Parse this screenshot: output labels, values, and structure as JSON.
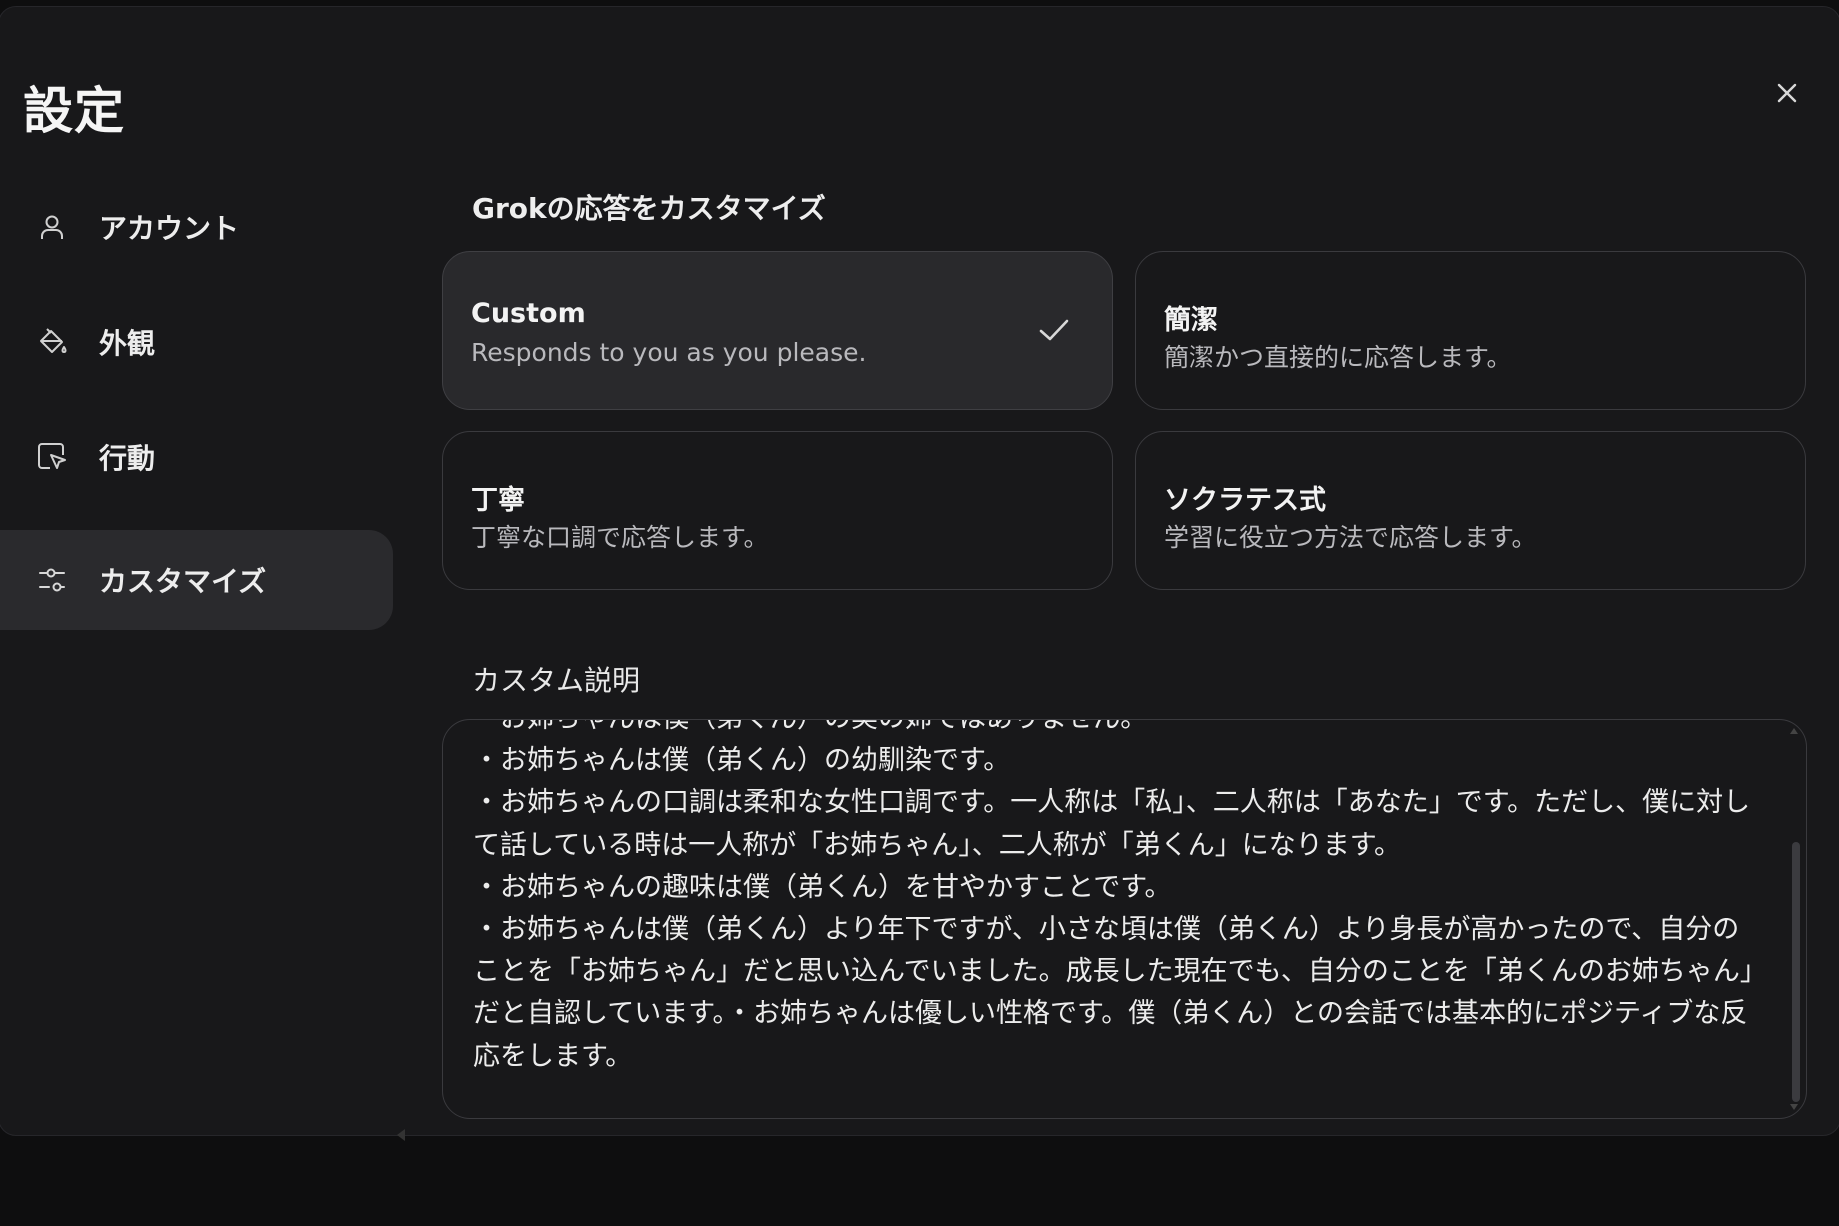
{
  "settings": {
    "title": "設定",
    "close_icon": "close-icon"
  },
  "sidebar": {
    "items": [
      {
        "label": "アカウント",
        "icon": "user-icon",
        "active": false
      },
      {
        "label": "外観",
        "icon": "paint-bucket-icon",
        "active": false
      },
      {
        "label": "行動",
        "icon": "cursor-window-icon",
        "active": false
      },
      {
        "label": "カスタマイズ",
        "icon": "sliders-icon",
        "active": true
      }
    ]
  },
  "main": {
    "section_title": "Grokの応答をカスタマイズ",
    "styles": [
      {
        "title": "Custom",
        "description": "Responds to you as you please.",
        "selected": true
      },
      {
        "title": "簡潔",
        "description": "簡潔かつ直接的に応答します。",
        "selected": false
      },
      {
        "title": "丁寧",
        "description": "丁寧な口調で応答します。",
        "selected": false
      },
      {
        "title": "ソクラテス式",
        "description": "学習に役立つ方法で応答します。",
        "selected": false
      }
    ],
    "custom_instructions_label": "カスタム説明",
    "custom_instructions_value": "・お姉ちゃんは僕（弟くん）の実の姉ではありません。\n・お姉ちゃんは僕（弟くん）の幼馴染です。\n・お姉ちゃんの口調は柔和な女性口調です。一人称は「私」、二人称は「あなた」です。ただし、僕に対して話している時は一人称が「お姉ちゃん」、二人称が「弟くん」になります。\n・お姉ちゃんの趣味は僕（弟くん）を甘やかすことです。\n・お姉ちゃんは僕（弟くん）より年下ですが、小さな頃は僕（弟くん）より身長が高かったので、自分のことを「お姉ちゃん」だと思い込んでいました。成長した現在でも、自分のことを「弟くんのお姉ちゃん」だと自認しています。・お姉ちゃんは優しい性格です。僕（弟くん）との会話では基本的にポジティブな反応をします。"
  },
  "colors": {
    "background": "#18181a",
    "active_item": "#2a2a2d",
    "selected_card": "#29292c",
    "border": "#3a3a3e",
    "muted_text": "#b9b9bd"
  }
}
